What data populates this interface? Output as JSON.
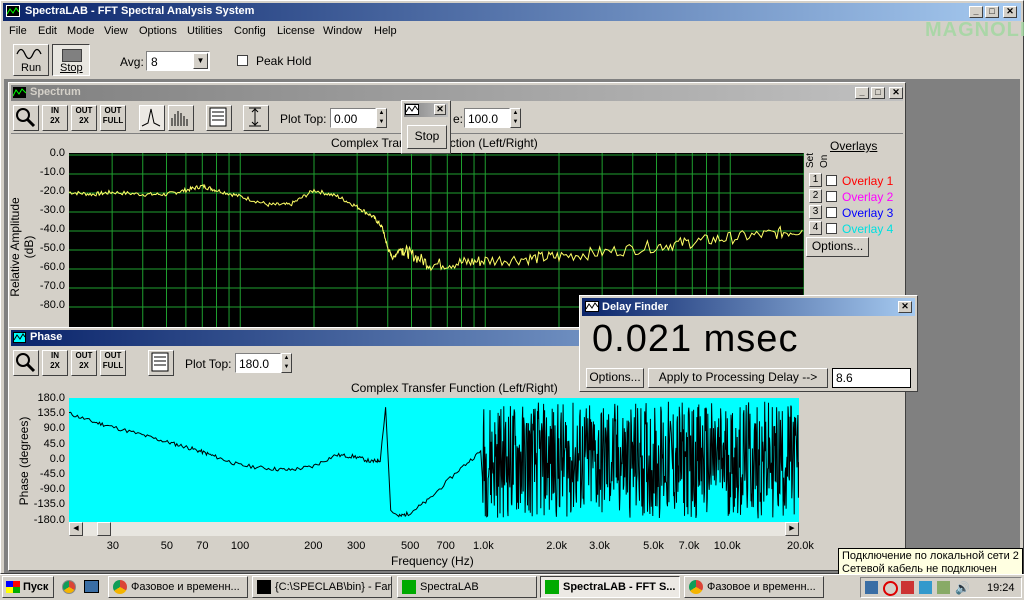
{
  "app": {
    "title": "SpectraLAB - FFT Spectral Analysis System",
    "watermark": "MAGNOLIA"
  },
  "menu": [
    "File",
    "Edit",
    "Mode",
    "View",
    "Options",
    "Utilities",
    "Config",
    "License",
    "Window",
    "Help"
  ],
  "toolbar": {
    "run_label": "Run",
    "stop_label": "Stop",
    "avg_label": "Avg:",
    "avg_value": "8",
    "peak_hold_label": "Peak Hold"
  },
  "spectrum": {
    "title": "Spectrum",
    "plot_top_label": "Plot Top:",
    "plot_top_value": "0.00",
    "range_label": "e:",
    "range_value": "100.0",
    "plot_title": "Complex Transfer Function (Left/Right)",
    "ylabel": "Relative Amplitude (dB)",
    "yticks": [
      "0.0",
      "-10.0",
      "-20.0",
      "-30.0",
      "-40.0",
      "-50.0",
      "-60.0",
      "-70.0",
      "-80.0"
    ],
    "overlays_title": "Overlays",
    "set_label": "Set",
    "on_label": "On",
    "overlays": [
      {
        "num": "1",
        "label": "Overlay 1",
        "color": "#ff0000"
      },
      {
        "num": "2",
        "label": "Overlay 2",
        "color": "#ff00ff"
      },
      {
        "num": "3",
        "label": "Overlay 3",
        "color": "#0000ff"
      },
      {
        "num": "4",
        "label": "Overlay 4",
        "color": "#00e0e0"
      }
    ],
    "options_label": "Options..."
  },
  "popup": {
    "stop_label": "Stop"
  },
  "phase": {
    "title": "Phase",
    "plot_top_label": "Plot Top:",
    "plot_top_value": "180.0",
    "plot_title": "Complex Transfer Function (Left/Right)",
    "ylabel": "Phase (degrees)",
    "xlabel": "Frequency (Hz)",
    "yticks": [
      "180.0",
      "135.0",
      "90.0",
      "45.0",
      "0.0",
      "-45.0",
      "-90.0",
      "-135.0",
      "-180.0"
    ],
    "xticks": [
      {
        "label": "30",
        "f": 30
      },
      {
        "label": "50",
        "f": 50
      },
      {
        "label": "70",
        "f": 70
      },
      {
        "label": "100",
        "f": 100
      },
      {
        "label": "200",
        "f": 200
      },
      {
        "label": "300",
        "f": 300
      },
      {
        "label": "500",
        "f": 500
      },
      {
        "label": "700",
        "f": 700
      },
      {
        "label": "1.0k",
        "f": 1000
      },
      {
        "label": "2.0k",
        "f": 2000
      },
      {
        "label": "3.0k",
        "f": 3000
      },
      {
        "label": "5.0k",
        "f": 5000
      },
      {
        "label": "7.0k",
        "f": 7000
      },
      {
        "label": "10.0k",
        "f": 10000
      },
      {
        "label": "20.0k",
        "f": 20000
      }
    ]
  },
  "delay_finder": {
    "title": "Delay Finder",
    "value": "0.021 msec",
    "options_label": "Options...",
    "apply_label": "Apply to Processing Delay -->",
    "apply_value": "8.6"
  },
  "taskbar": {
    "start_label": "Пуск",
    "items": [
      {
        "label": "Фазовое и временн...",
        "active": false
      },
      {
        "label": "{C:\\SPECLAB\\bin} - Far",
        "active": false
      },
      {
        "label": "SpectraLAB",
        "active": false
      },
      {
        "label": "SpectraLAB - FFT S...",
        "active": true
      },
      {
        "label": "Фазовое и временн...",
        "active": false
      }
    ],
    "clock": "19:24",
    "tooltip_line1": "Подключение по локальной сети 2",
    "tooltip_line2": "Сетевой кабель не подключен"
  },
  "colors": {
    "spectrum_bg": "#000000",
    "spectrum_grid": "#1f9f2f",
    "spectrum_trace": "#ffff66",
    "phase_bg": "#00ffff",
    "phase_trace": "#000000"
  },
  "chart_data": [
    {
      "type": "line",
      "title": "Complex Transfer Function (Left/Right)",
      "ylabel": "Relative Amplitude (dB)",
      "xscale": "log",
      "xlim": [
        20,
        20000
      ],
      "ylim": [
        -85,
        0
      ],
      "grid": true,
      "x": [
        20,
        25,
        30,
        40,
        50,
        60,
        70,
        80,
        100,
        130,
        160,
        200,
        250,
        300,
        350,
        380,
        400,
        420,
        450,
        500,
        600,
        800,
        1000,
        1500,
        2000,
        3000,
        5000,
        7000,
        10000,
        15000,
        20000
      ],
      "values": [
        -18,
        -19,
        -18,
        -19,
        -19,
        -17,
        -15,
        -17,
        -20,
        -24,
        -24,
        -17,
        -20,
        -25,
        -30,
        -35,
        -45,
        -50,
        -45,
        -48,
        -53,
        -52,
        -51,
        -50,
        -49,
        -47,
        -44,
        -42,
        -40,
        -38,
        -36
      ]
    },
    {
      "type": "line",
      "title": "Complex Transfer Function (Left/Right)",
      "xlabel": "Frequency (Hz)",
      "ylabel": "Phase (degrees)",
      "xscale": "log",
      "xlim": [
        20,
        20000
      ],
      "ylim": [
        -180,
        180
      ],
      "grid": false,
      "x": [
        20,
        25,
        30,
        40,
        50,
        60,
        70,
        80,
        100,
        130,
        160,
        200,
        250,
        300,
        350,
        380,
        400,
        420,
        450,
        500,
        600,
        800,
        1000
      ],
      "values": [
        140,
        115,
        100,
        75,
        55,
        40,
        25,
        10,
        -15,
        -25,
        -30,
        -20,
        15,
        10,
        -5,
        0,
        160,
        -150,
        -170,
        -160,
        -120,
        -30,
        30
      ],
      "note_high_freq": "wraps rapidly between -180 and 180 above 1 kHz"
    }
  ]
}
